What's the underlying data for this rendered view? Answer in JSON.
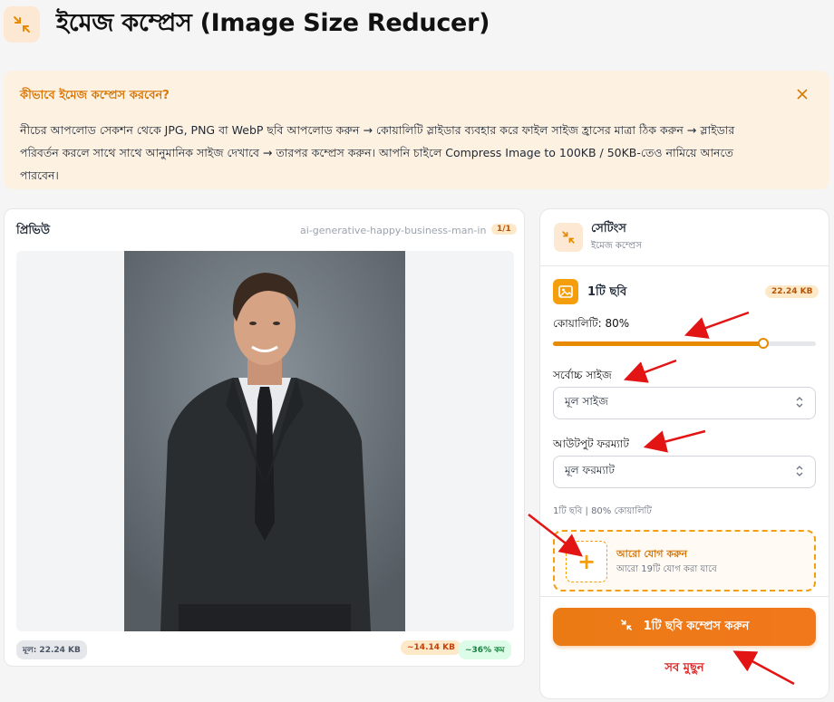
{
  "header": {
    "icon": "compress-icon",
    "title": "ইমেজ কম্প্রেস (Image Size Reducer)"
  },
  "info": {
    "title": "কীভাবে ইমেজ কম্প্রেস করবেন?",
    "lines": [
      "নীচের আপলোড সেকশন থেকে JPG, PNG বা WebP ছবি আপলোড করুন → কোয়ালিটি স্লাইডার ব্যবহার করে ফাইল সাইজ হ্রাসের মাত্রা ঠিক করুন → স্লাইডার",
      "পরিবর্তন করলে সাথে সাথে আনুমানিক সাইজ দেখাবে → তারপর কম্প্রেস করুন। আপনি চাইলে Compress Image to 100KB / 50KB-তেও নামিয়ে আনতে",
      "পারবেন।"
    ],
    "close_icon": "close-icon"
  },
  "preview": {
    "title": "প্রিভিউ",
    "filename": "ai-generative-happy-business-man-in...",
    "count": "1/1",
    "original_size": "মূল: 22.24 KB",
    "estimated_size": "~14.14 KB",
    "reduction": "~36% কম"
  },
  "settings": {
    "title": "সেটিংস",
    "subtitle": "ইমেজ কম্প্রেস",
    "image_count": "1টি ছবি",
    "image_size": "22.24 KB",
    "quality_label": "কোয়ালিটি: 80%",
    "quality": 0.8,
    "max_size_label": "সর্বোচ্চ সাইজ",
    "max_size_value": "মূল সাইজ",
    "format_label": "আউটপুট ফরম্যাট",
    "format_value": "মূল ফরম্যাট",
    "summary": "1টি ছবি | 80% কোয়ালিটি",
    "add_title": "আরো যোগ করুন",
    "add_sub": "আরো 19টি যোগ করা যাবে",
    "compress_button": "1টি ছবি কম্প্রেস করুন",
    "clear_button": "সব মুছুন"
  },
  "colors": {
    "accent": "#e68a00",
    "accent_light": "#fde9d3",
    "danger": "#dc2626",
    "annotation": "#e31414"
  }
}
